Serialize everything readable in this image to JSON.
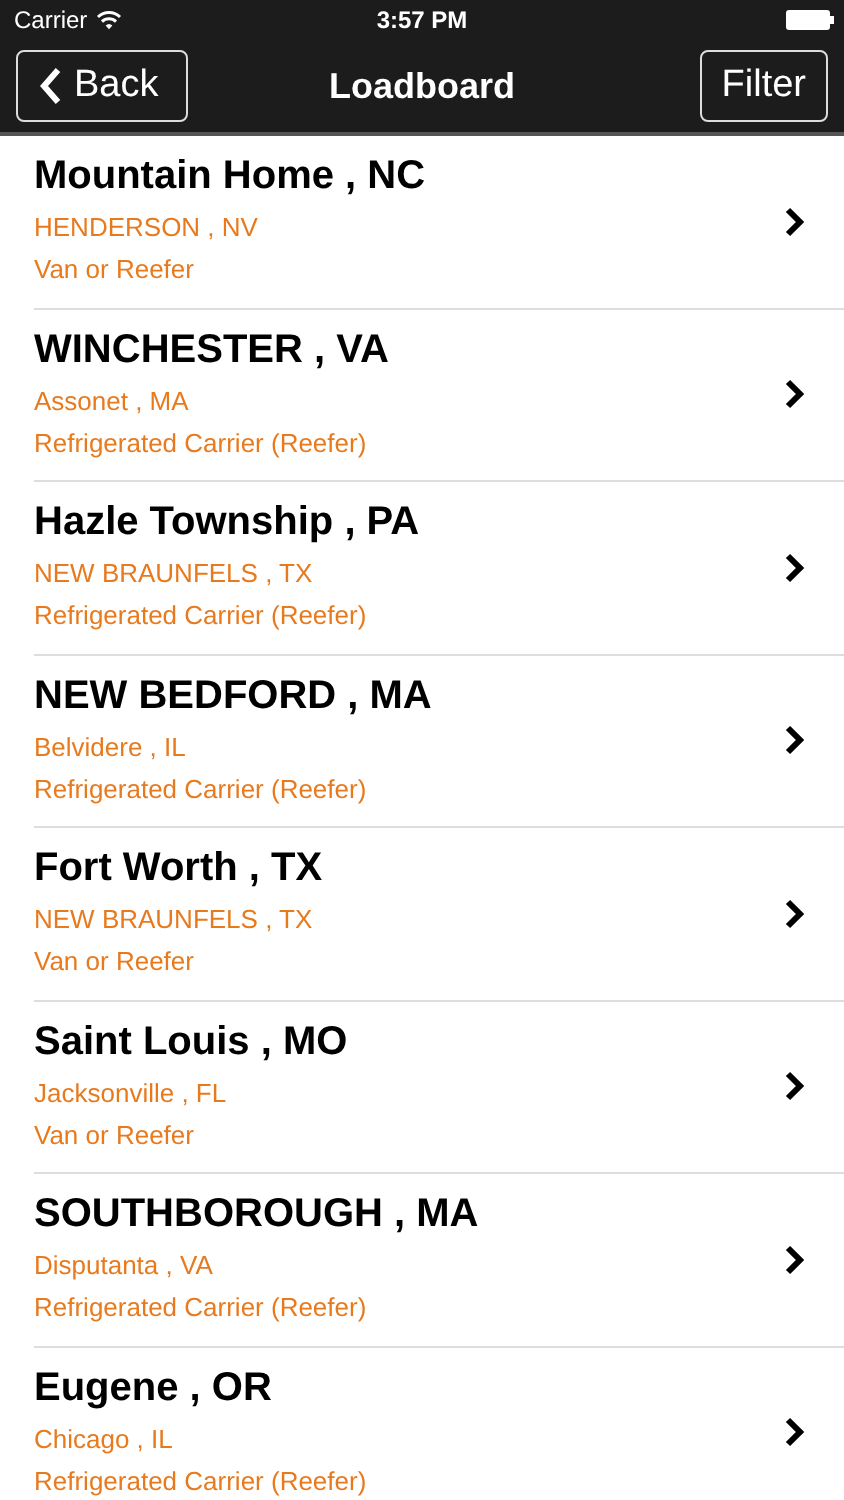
{
  "status_bar": {
    "carrier": "Carrier",
    "time": "3:57 PM"
  },
  "nav_bar": {
    "back": "Back",
    "title": "Loadboard",
    "filter": "Filter"
  },
  "loads": [
    {
      "destination": "Mountain Home , NC",
      "origin": "HENDERSON , NV",
      "equipment": "Van or Reefer"
    },
    {
      "destination": "WINCHESTER , VA",
      "origin": "Assonet , MA",
      "equipment": "Refrigerated Carrier (Reefer)"
    },
    {
      "destination": "Hazle Township , PA",
      "origin": "NEW BRAUNFELS , TX",
      "equipment": "Refrigerated Carrier (Reefer)"
    },
    {
      "destination": "NEW BEDFORD , MA",
      "origin": "Belvidere , IL",
      "equipment": "Refrigerated Carrier (Reefer)"
    },
    {
      "destination": "Fort Worth , TX",
      "origin": "NEW BRAUNFELS , TX",
      "equipment": "Van or Reefer"
    },
    {
      "destination": "Saint Louis , MO",
      "origin": "Jacksonville , FL",
      "equipment": "Van or Reefer"
    },
    {
      "destination": "SOUTHBOROUGH , MA",
      "origin": "Disputanta , VA",
      "equipment": "Refrigerated Carrier (Reefer)"
    },
    {
      "destination": "Eugene , OR",
      "origin": "Chicago , IL",
      "equipment": "Refrigerated Carrier (Reefer)"
    }
  ]
}
